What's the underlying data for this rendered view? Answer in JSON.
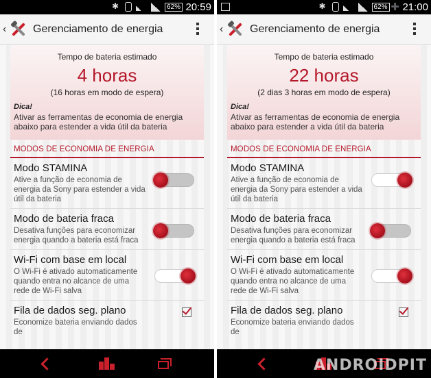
{
  "watermark": "ANDROIDPIT",
  "screens": [
    {
      "status": {
        "time": "20:59",
        "battery": "62%"
      },
      "app_title": "Gerenciamento de energia",
      "summary": {
        "label": "Tempo de bateria estimado",
        "value": "4 horas",
        "standby": "(16 horas em modo de espera)",
        "tip_title": "Dica!",
        "tip_text": "Ativar as ferramentas de economia de energia abaixo para estender a vida útil da bateria"
      },
      "section_header": "MODOS DE ECONOMIA DE ENERGIA",
      "items": [
        {
          "title": "Modo STAMINA",
          "desc": "Ative a função de economia de energia da Sony para estender a vida útil da bateria",
          "state": "off"
        },
        {
          "title": "Modo de bateria fraca",
          "desc": "Desativa funções para economizar energia quando a bateria está fraca",
          "state": "off"
        },
        {
          "title": "Wi-Fi com base em local",
          "desc": "O Wi-Fi é ativado automaticamente quando entra no alcance de uma rede de Wi-Fi salva",
          "state": "on"
        },
        {
          "title": "Fila de dados seg. plano",
          "desc": "Economize bateria enviando dados de",
          "state": "checked"
        }
      ]
    },
    {
      "status": {
        "time": "21:00",
        "battery": "62%"
      },
      "app_title": "Gerenciamento de energia",
      "summary": {
        "label": "Tempo de bateria estimado",
        "value": "22 horas",
        "standby": "(2 dias 3 horas em modo de espera)",
        "tip_title": "Dica!",
        "tip_text": "Ativar as ferramentas de economia de energia abaixo para estender a vida útil da bateria"
      },
      "section_header": "MODOS DE ECONOMIA DE ENERGIA",
      "items": [
        {
          "title": "Modo STAMINA",
          "desc": "Ative a função de economia de energia da Sony para estender a vida útil da bateria",
          "state": "on"
        },
        {
          "title": "Modo de bateria fraca",
          "desc": "Desativa funções para economizar energia quando a bateria está fraca",
          "state": "off"
        },
        {
          "title": "Wi-Fi com base em local",
          "desc": "O Wi-Fi é ativado automaticamente quando entra no alcance de uma rede de Wi-Fi salva",
          "state": "on"
        },
        {
          "title": "Fila de dados seg. plano",
          "desc": "Economize bateria enviando dados de",
          "state": "checked"
        }
      ]
    }
  ]
}
